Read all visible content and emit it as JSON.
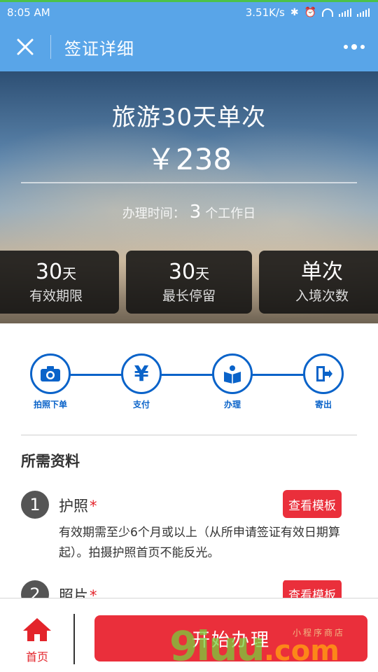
{
  "status_bar": {
    "time": "8:05 AM",
    "net_speed": "3.51K/s"
  },
  "nav": {
    "title": "签证详细"
  },
  "hero": {
    "title": "旅游30天单次",
    "price": "￥238",
    "time_label": "办理时间：",
    "time_value": "3",
    "time_unit": "个工作日",
    "stats": [
      {
        "value": "30",
        "unit": "天",
        "label": "有效期限"
      },
      {
        "value": "30",
        "unit": "天",
        "label": "最长停留"
      },
      {
        "value": "单次",
        "unit": "",
        "label": "入境次数"
      }
    ]
  },
  "steps": [
    {
      "label": "拍照下单",
      "icon": "camera-icon"
    },
    {
      "label": "支付",
      "icon": "yen-icon"
    },
    {
      "label": "办理",
      "icon": "book-person-icon"
    },
    {
      "label": "寄出",
      "icon": "exit-door-icon"
    }
  ],
  "requirements": {
    "title": "所需资料",
    "items": [
      {
        "number": "1",
        "name": "护照",
        "required_mark": "*",
        "button": "查看模板",
        "description": "有效期需至少6个月或以上（从所申请签证有效日期算起）。拍摄护照首页不能反光。"
      },
      {
        "number": "2",
        "name": "照片",
        "required_mark": "*",
        "button": "查看模板"
      }
    ]
  },
  "bottom": {
    "home_label": "首页",
    "start_button": "开始办理",
    "watermark_main": "9iuu",
    "watermark_suffix": ".com",
    "watermark_small": "小程序商店"
  },
  "colors": {
    "header_blue": "#59a5e8",
    "step_blue": "#0a63c9",
    "accent_red": "#ea2f3b"
  }
}
